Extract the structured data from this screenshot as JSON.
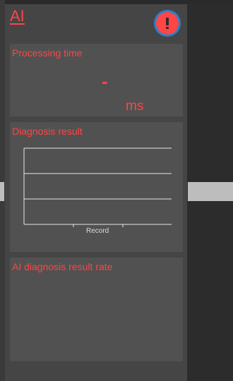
{
  "app": {
    "title": "AI"
  },
  "alert": {
    "icon": "exclamation-icon",
    "color": "#ff4545",
    "ring_color": "#2a81c8"
  },
  "processing": {
    "title": "Processing time",
    "value": "-",
    "unit": "ms"
  },
  "diagnosis": {
    "title": "Diagnosis result",
    "xlabel": "Record"
  },
  "rate": {
    "title": "AI diagnosis result rate"
  },
  "colors": {
    "accent": "#ff4545",
    "panel": "#454545",
    "card": "#515151",
    "background": "#2b2b2b"
  }
}
